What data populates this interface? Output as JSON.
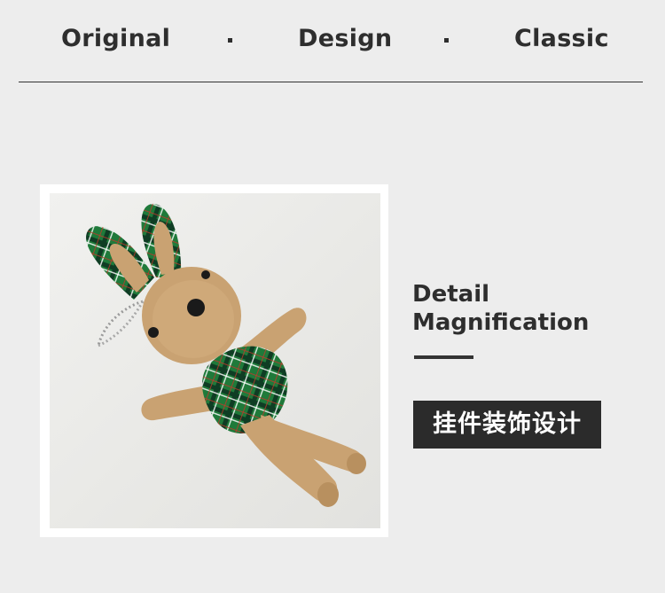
{
  "nav": {
    "word1": "Original",
    "word2": "Design",
    "word3": "Classic"
  },
  "detail": {
    "line1": "Detail",
    "line2": "Magnification"
  },
  "tag": {
    "label": "挂件装饰设计"
  },
  "colors": {
    "background": "#ededed",
    "text": "#2e2e2e",
    "tag_bg": "#2b2b2b",
    "tag_text": "#ffffff",
    "plush_body": "#c9a272",
    "plaid_green": "#1f7a3a"
  },
  "image": {
    "subject": "plush-bunny-keychain"
  }
}
